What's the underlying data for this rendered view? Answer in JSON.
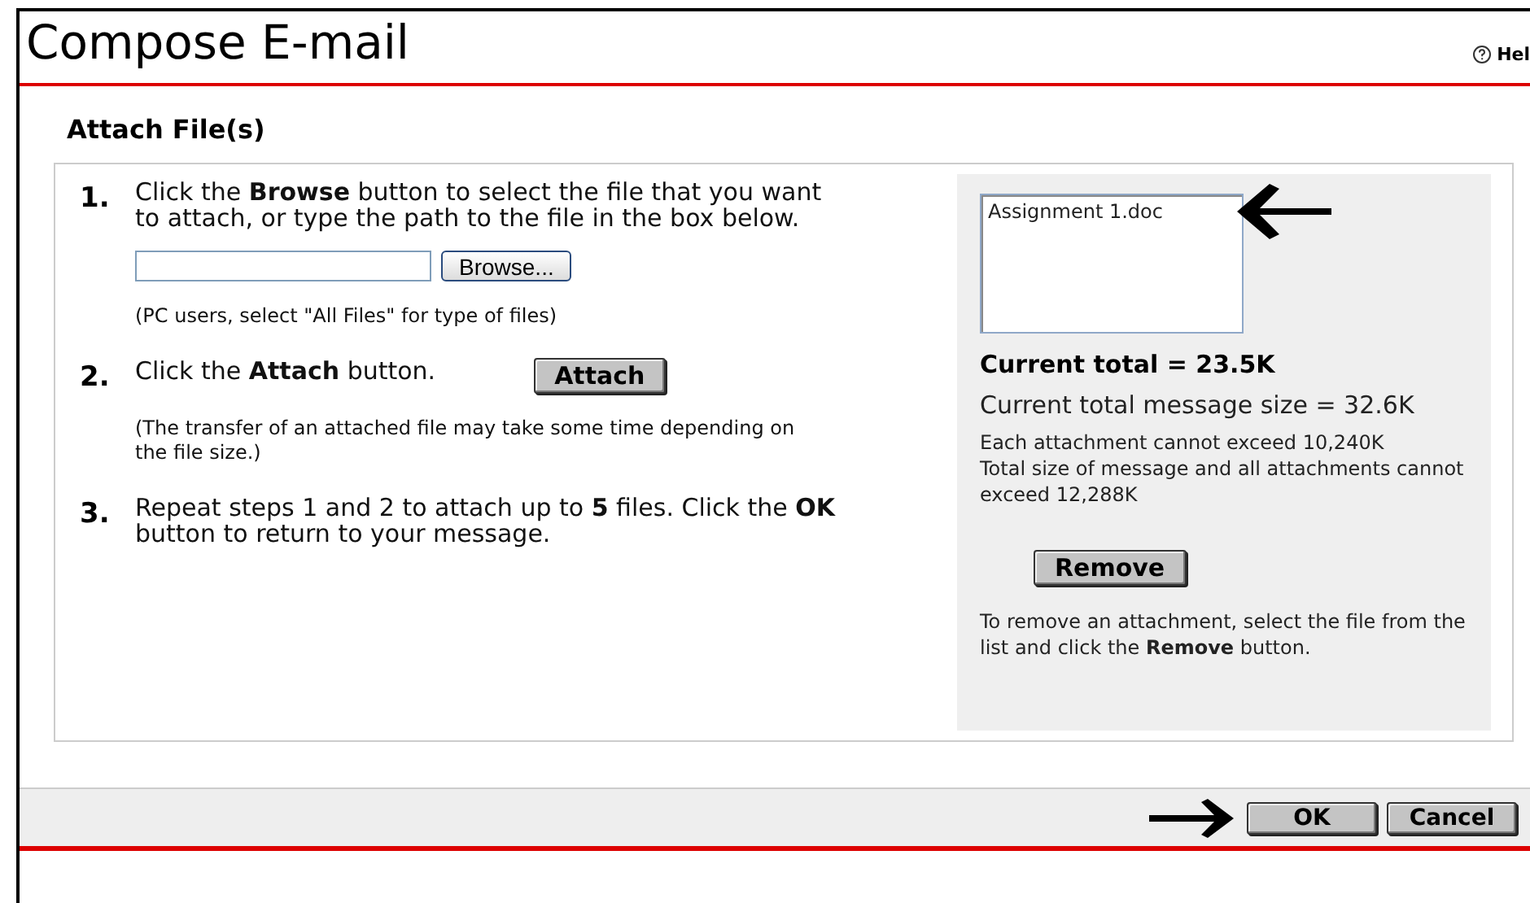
{
  "window": {
    "title": "Compose E-mail",
    "help": "Hel"
  },
  "section_title": "Attach File(s)",
  "steps": [
    {
      "number": "1.",
      "text": "Click the **Browse** button to select the file that you want to attach, or type the path to the file in the box below.",
      "kind": "browse",
      "browse_button": "Browse...",
      "note": "(PC users, select \"All Files\" for type of files)"
    },
    {
      "number": "2.",
      "text": "Click the **Attach** button.",
      "kind": "attach",
      "attach_button": "Attach",
      "note": "(The transfer of an attached file may take some time depending on the file size.)"
    },
    {
      "number": "3.",
      "text": "Repeat steps 1 and 2 to attach up to **5** files. Click the **OK** button to return to your message.",
      "kind": "plain"
    }
  ],
  "attachments": [
    {
      "name": "Assignment 1.doc",
      "selected": false
    }
  ],
  "current_total": "Current total = 23.5K",
  "message_size": "Current total message size = 32.6K",
  "limits": [
    "Each attachment cannot exceed 10,240K",
    "Total size of message and all attachments cannot exceed 12,288K"
  ],
  "remove_button": "Remove",
  "remove_help": "To remove an attachment, select the file from the list and click the **Remove** button.",
  "buttons": [
    "OK",
    "Cancel"
  ]
}
